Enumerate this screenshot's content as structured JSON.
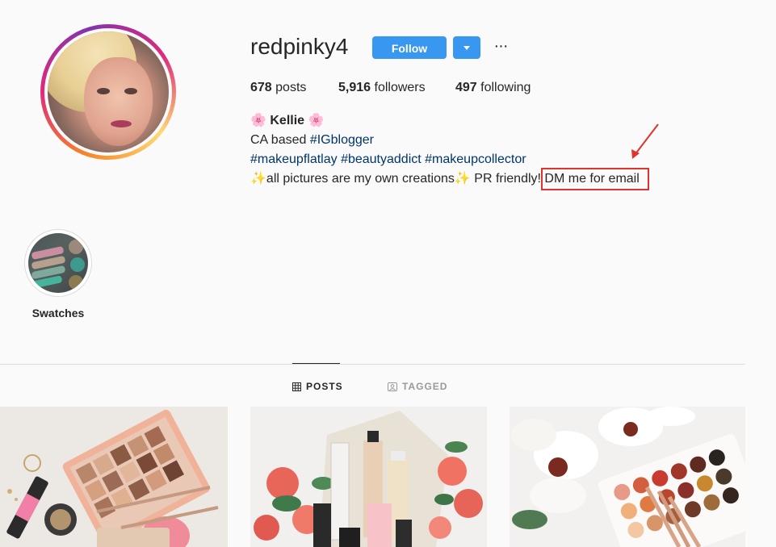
{
  "profile": {
    "username": "redpinky4",
    "follow_label": "Follow",
    "more_label": "···",
    "stats": {
      "posts_count": "678",
      "posts_label": "posts",
      "followers_count": "5,916",
      "followers_label": "followers",
      "following_count": "497",
      "following_label": "following"
    },
    "bio": {
      "name": "Kellie",
      "name_emoji": "🌸",
      "line1_prefix": "CA based ",
      "line1_tag": "#IGblogger",
      "line2_tags": "#makeupflatlay #beautyaddict #makeupcollector",
      "line3_sparkle": "✨",
      "line3_text": "all pictures are my own creations",
      "line3_pr": " PR friendly! ",
      "line3_dm": "DM me for email"
    }
  },
  "highlights": [
    {
      "label": "Swatches"
    }
  ],
  "tabs": [
    {
      "label": "POSTS",
      "active": true
    },
    {
      "label": "TAGGED",
      "active": false
    }
  ],
  "colors": {
    "accent": "#3897f0",
    "annotation": "#e0322f",
    "link": "#003569"
  }
}
